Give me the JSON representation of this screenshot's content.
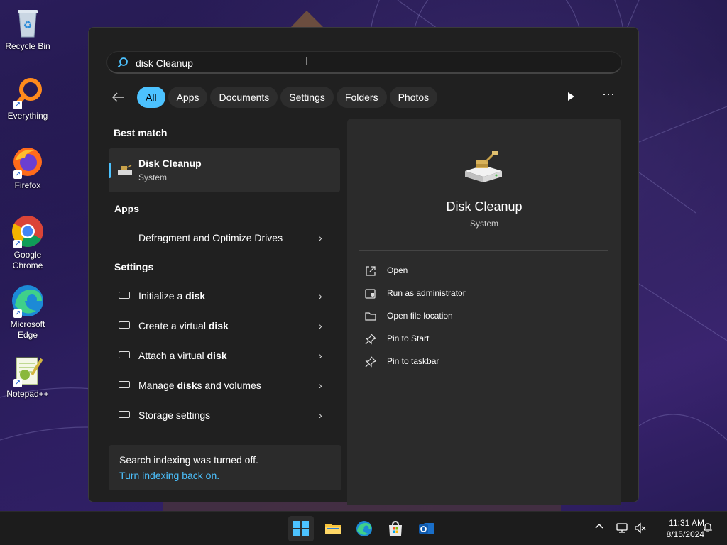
{
  "desktop": {
    "icons": [
      {
        "label": "Recycle Bin",
        "icon": "recycle-bin-icon"
      },
      {
        "label": "Everything",
        "icon": "everything-icon"
      },
      {
        "label": "Firefox",
        "icon": "firefox-icon"
      },
      {
        "label": "Google\nChrome",
        "label_line1": "Google",
        "label_line2": "Chrome",
        "icon": "chrome-icon"
      },
      {
        "label_line1": "Microsoft",
        "label_line2": "Edge",
        "icon": "edge-icon"
      },
      {
        "label": "Notepad++",
        "icon": "notepadpp-icon"
      }
    ]
  },
  "search": {
    "query": "disk Cleanup",
    "filters": [
      "All",
      "Apps",
      "Documents",
      "Settings",
      "Folders",
      "Photos"
    ],
    "active_filter": "All"
  },
  "results": {
    "best_match_heading": "Best match",
    "best_match": {
      "title": "Disk Cleanup",
      "subtitle": "System"
    },
    "apps_heading": "Apps",
    "apps": [
      {
        "label": "Defragment and Optimize Drives"
      }
    ],
    "settings_heading": "Settings",
    "settings": [
      {
        "pre": "Initialize a ",
        "bold": "disk",
        "post": ""
      },
      {
        "pre": "Create a virtual ",
        "bold": "disk",
        "post": ""
      },
      {
        "pre": "Attach a virtual ",
        "bold": "disk",
        "post": ""
      },
      {
        "pre": "Manage ",
        "bold": "disk",
        "post": "s and volumes"
      },
      {
        "pre": "Storage settings",
        "bold": "",
        "post": ""
      }
    ],
    "notice": {
      "text": "Search indexing was turned off.",
      "link": "Turn indexing back on."
    }
  },
  "preview": {
    "title": "Disk Cleanup",
    "subtitle": "System",
    "actions": [
      {
        "label": "Open",
        "icon": "open-external-icon"
      },
      {
        "label": "Run as administrator",
        "icon": "shield-admin-icon"
      },
      {
        "label": "Open file location",
        "icon": "folder-icon"
      },
      {
        "label": "Pin to Start",
        "icon": "pin-icon"
      },
      {
        "label": "Pin to taskbar",
        "icon": "pin-icon"
      }
    ]
  },
  "taskbar": {
    "apps": [
      "start-icon",
      "file-explorer-icon",
      "edge-icon",
      "store-icon",
      "outlook-icon"
    ],
    "clock": {
      "time": "11:31 AM",
      "date": "8/15/2024"
    }
  },
  "colors": {
    "accent": "#4cc2ff",
    "panel": "#202020",
    "preview": "#2b2b2b"
  }
}
